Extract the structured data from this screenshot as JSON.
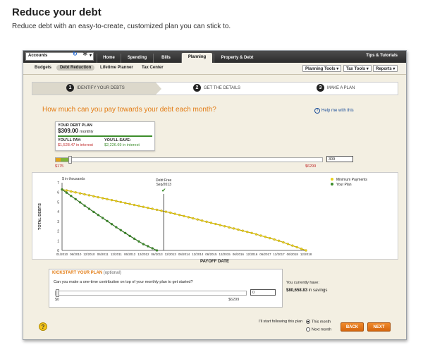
{
  "page": {
    "title": "Reduce your debt",
    "subtitle": "Reduce debt with an easy-to-create, customized plan you can stick to."
  },
  "nav": {
    "account": "Accounts",
    "tabs": [
      "Home",
      "Spending",
      "Bills",
      "Planning",
      "Property & Debt"
    ],
    "active_tab": "Planning",
    "tips": "Tips & Tutorials"
  },
  "subnav": {
    "items": [
      "Budgets",
      "Debt Reduction",
      "Lifetime Planner",
      "Tax Center"
    ],
    "active": "Debt Reduction",
    "buttons": [
      "Planning Tools ▾",
      "Tax Tools ▾",
      "Reports ▾"
    ]
  },
  "steps": [
    {
      "num": "1",
      "label": "IDENTIFY YOUR DEBTS"
    },
    {
      "num": "2",
      "label": "GET THE DETAILS"
    },
    {
      "num": "3",
      "label": "MAKE A PLAN"
    }
  ],
  "question": "How much can you pay towards your debt each month?",
  "help_link": "Help me with this",
  "plan": {
    "label": "YOUR DEBT PLAN",
    "amount": "$309.00",
    "per": "monthly",
    "pay_label": "YOU'LL PAY:",
    "pay_value": "$1,528.47 in interest",
    "save_label": "YOU'LL SAVE:",
    "save_value": "$2,226.69 in interest"
  },
  "payment_slider": {
    "min_label": "$175",
    "max_label": "$6299",
    "input_value": "309",
    "position": 0.03
  },
  "chart_data": {
    "type": "line",
    "ylabel": "TOTAL DEBTS",
    "xlabel": "PAYOFF DATE",
    "unit_label": "$ in thousands",
    "ylim": [
      0,
      7
    ],
    "y_ticks": [
      "0",
      "1",
      "2",
      "3",
      "4",
      "5",
      "6",
      "7"
    ],
    "categories": [
      "01/2010",
      "06/2010",
      "12/2010",
      "06/2011",
      "12/2011",
      "06/2012",
      "12/2012",
      "06/2013",
      "12/2013",
      "06/2014",
      "12/2014",
      "06/2015",
      "12/2015",
      "06/2016",
      "12/2016",
      "06/2017",
      "12/2017",
      "06/2018",
      "12/2018"
    ],
    "series": [
      {
        "name": "Minimum Payments",
        "color": "#e8d21a",
        "values": [
          6.3,
          6.0,
          5.7,
          5.4,
          5.1,
          4.8,
          4.5,
          4.2,
          3.9,
          3.55,
          3.2,
          2.85,
          2.5,
          2.15,
          1.8,
          1.4,
          1.0,
          0.5,
          0.0
        ]
      },
      {
        "name": "Your Plan",
        "color": "#3c8d2b",
        "values": [
          6.3,
          5.3,
          4.3,
          3.35,
          2.4,
          1.5,
          0.65,
          0.0,
          null,
          null,
          null,
          null,
          null,
          null,
          null,
          null,
          null,
          null,
          null
        ]
      }
    ],
    "annotation": {
      "label": "Debt Free",
      "date": "Sep/2013",
      "x_index": 7.5
    },
    "legend_position": "top-right"
  },
  "kickstart": {
    "title": "KICKSTART YOUR PLAN",
    "optional": "(optional)",
    "question": "Can you make a one-time contribution on top of your monthly plan to get started?",
    "min_label": "$0",
    "max_label": "$6299",
    "input_value": "0",
    "position": 0
  },
  "savings": {
    "label": "You currently have:",
    "amount": "$80,658.83",
    "suffix": "in savings"
  },
  "start": {
    "label": "I'll start following this plan",
    "options": [
      "This month",
      "Next month"
    ],
    "selected": "This month"
  },
  "buttons": {
    "back": "BACK",
    "next": "NEXT"
  },
  "colors": {
    "accent": "#e37b12",
    "green": "#3c8d2b",
    "yellow": "#e8d21a"
  }
}
